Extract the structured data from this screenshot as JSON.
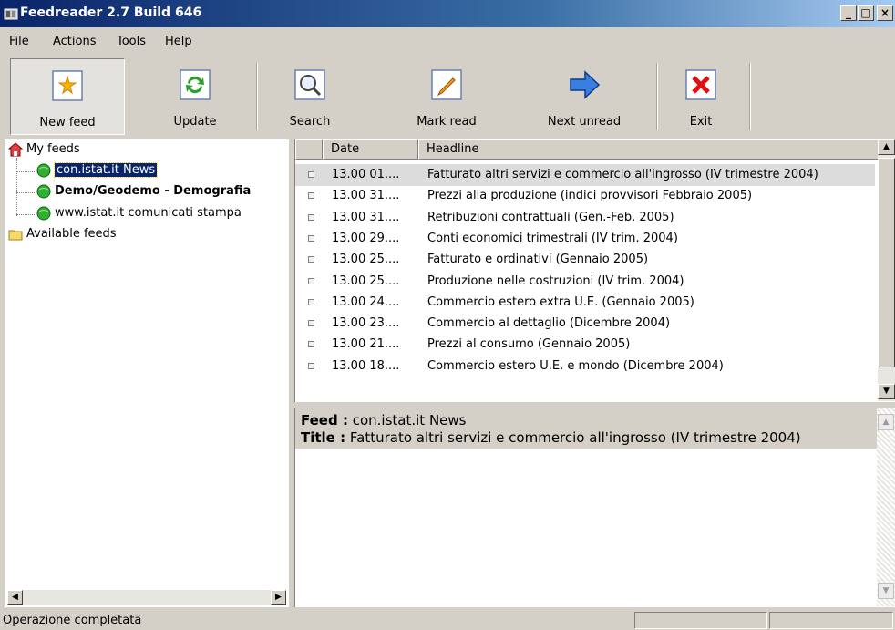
{
  "window": {
    "title": "Feedreader 2.7 Build 646",
    "minimize_label": "_",
    "maximize_label": "□",
    "close_label": "×"
  },
  "menu": [
    "File",
    "Actions",
    "Tools",
    "Help"
  ],
  "toolbar": [
    {
      "label": "New feed",
      "icon": "new-feed-icon"
    },
    {
      "label": "Update",
      "icon": "update-icon"
    },
    {
      "label": "Search",
      "icon": "search-icon"
    },
    {
      "label": "Mark read",
      "icon": "pencil-icon"
    },
    {
      "label": "Next unread",
      "icon": "arrow-right-icon"
    },
    {
      "label": "Exit",
      "icon": "exit-icon"
    }
  ],
  "tree": {
    "root": "My feeds",
    "feeds": [
      {
        "label": "con.istat.it  News",
        "selected": true,
        "bold": false
      },
      {
        "label": "Demo/Geodemo - Demografia",
        "selected": false,
        "bold": true
      },
      {
        "label": "www.istat.it comunicati stampa",
        "selected": false,
        "bold": false
      }
    ],
    "available": "Available feeds"
  },
  "list": {
    "columns": [
      "Date",
      "Headline"
    ],
    "rows": [
      {
        "date": "13.00 01....",
        "headline": "Fatturato altri servizi e commercio all'ingrosso (IV trimestre 2004)",
        "selected": true
      },
      {
        "date": "13.00 31....",
        "headline": "Prezzi alla produzione (indici provvisori Febbraio 2005)"
      },
      {
        "date": "13.00 31....",
        "headline": "Retribuzioni contrattuali (Gen.-Feb. 2005)"
      },
      {
        "date": "13.00 29....",
        "headline": "Conti economici trimestrali (IV trim. 2004)"
      },
      {
        "date": "13.00 25....",
        "headline": "Fatturato e ordinativi (Gennaio 2005)"
      },
      {
        "date": "13.00 25....",
        "headline": "Produzione nelle costruzioni (IV trim. 2004)"
      },
      {
        "date": "13.00 24....",
        "headline": "Commercio estero extra U.E. (Gennaio 2005)"
      },
      {
        "date": "13.00 23....",
        "headline": "Commercio al dettaglio (Dicembre 2004)"
      },
      {
        "date": "13.00 21....",
        "headline": "Prezzi al consumo (Gennaio 2005)"
      },
      {
        "date": "13.00 18....",
        "headline": "Commercio estero U.E. e mondo (Dicembre 2004)"
      }
    ]
  },
  "details": {
    "feed_label": "Feed :",
    "feed_value": "con.istat.it  News",
    "title_label": "Title :",
    "title_value": "Fatturato altri servizi e commercio all'ingrosso (IV trimestre 2004)"
  },
  "status": {
    "text": "Operazione completata"
  }
}
